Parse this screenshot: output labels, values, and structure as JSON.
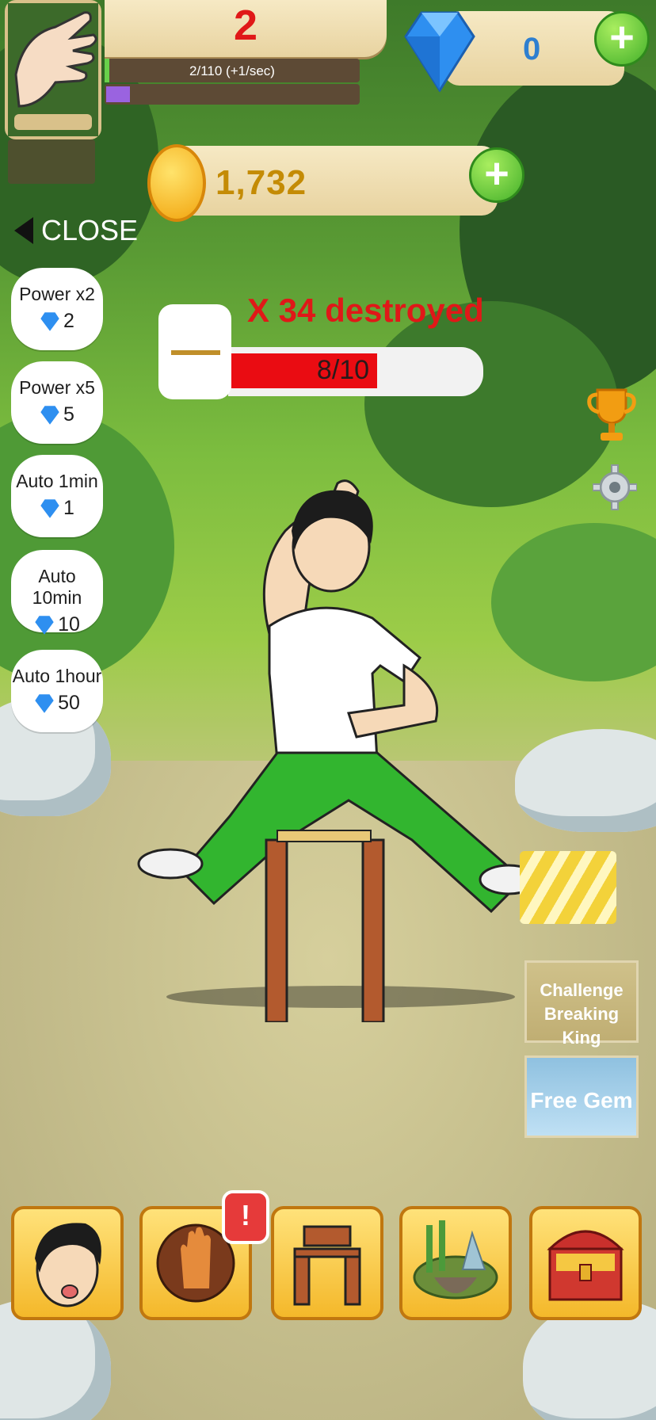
{
  "player": {
    "level": "2",
    "xp_text": "2/110 (+1/sec)",
    "xp_progress": 0.02
  },
  "currency": {
    "gems": "0",
    "coins": "1,732"
  },
  "close_label": "CLOSE",
  "powerups": [
    {
      "label": "Power x2",
      "cost": "2"
    },
    {
      "label": "Power x5",
      "cost": "5"
    },
    {
      "label": "Auto 1min",
      "cost": "1"
    },
    {
      "label": "Auto 10min",
      "cost": "10"
    },
    {
      "label": "Auto 1hour",
      "cost": "50"
    }
  ],
  "target": {
    "destroyed_text": "X 34 destroyed",
    "progress_text": "8/10",
    "progress": 0.8
  },
  "side": {
    "challenge_label": "Challenge Breaking King",
    "free_gem_label": "Free Gem"
  },
  "bottom_nav": {
    "alert_badge": "!",
    "items": [
      "character",
      "skills",
      "board",
      "world",
      "treasure"
    ]
  },
  "icons": [
    "hand-icon",
    "diamond-icon",
    "coin-icon",
    "plus-icon",
    "trophy-icon",
    "gear-icon",
    "gold-bars-icon"
  ],
  "colors": {
    "level": "#e01818",
    "progress_fill": "#ea0c12",
    "plus_button": "#43b02a",
    "gem": "#2e7fd0"
  }
}
